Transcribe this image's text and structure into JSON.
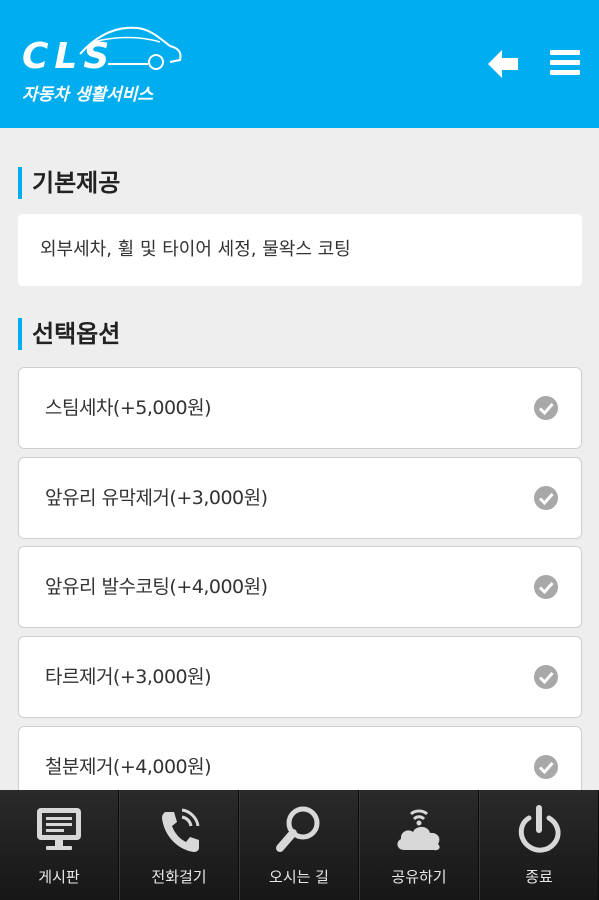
{
  "header": {
    "logo_text": "CLS",
    "logo_subtitle": "자동차 생활서비스",
    "back_icon": "arrow-left-icon",
    "menu_icon": "hamburger-menu-icon",
    "color": "#00aeef"
  },
  "basic": {
    "title": "기본제공",
    "content": "외부세차, 휠 및 타이어 세정, 물왁스 코팅"
  },
  "options": {
    "title": "선택옵션",
    "items": [
      {
        "label": "스팀세차(+5,000원)"
      },
      {
        "label": "앞유리 유막제거(+3,000원)"
      },
      {
        "label": "앞유리 발수코팅(+4,000원)"
      },
      {
        "label": "타르제거(+3,000원)"
      },
      {
        "label": "철분제거(+4,000원)"
      }
    ]
  },
  "bottom_nav": {
    "items": [
      {
        "label": "게시판",
        "icon": "monitor-icon"
      },
      {
        "label": "전화걸기",
        "icon": "phone-icon"
      },
      {
        "label": "오시는 길",
        "icon": "magnifier-icon"
      },
      {
        "label": "공유하기",
        "icon": "cloud-share-icon"
      },
      {
        "label": "종료",
        "icon": "power-icon"
      }
    ]
  }
}
